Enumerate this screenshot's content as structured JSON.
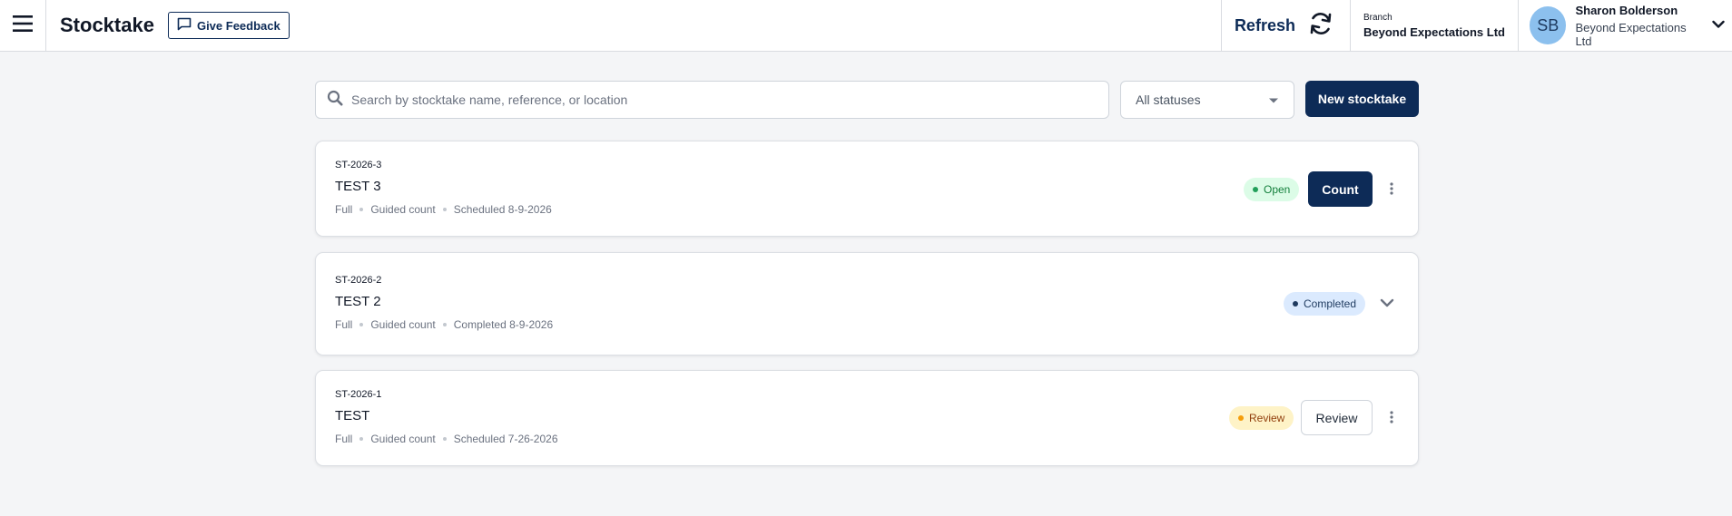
{
  "header": {
    "title": "Stocktake",
    "feedback_label": "Give Feedback",
    "refresh_label": "Refresh",
    "branch_caption": "Branch",
    "branch_name": "Beyond Expectations Ltd",
    "user": {
      "initials": "SB",
      "name": "Sharon Bolderson",
      "company": "Beyond Expectations Ltd"
    }
  },
  "toolbar": {
    "search_placeholder": "Search by stocktake name, reference, or location",
    "status_filter": "All statuses",
    "new_button": "New stocktake"
  },
  "stocktakes": [
    {
      "reference": "ST-2026-3",
      "name": "TEST 3",
      "scope": "Full",
      "method": "Guided count",
      "date_text": "Scheduled 8-9-2026",
      "status": "Open",
      "action": "Count"
    },
    {
      "reference": "ST-2026-2",
      "name": "TEST 2",
      "scope": "Full",
      "method": "Guided count",
      "date_text": "Completed 8-9-2026",
      "status": "Completed"
    },
    {
      "reference": "ST-2026-1",
      "name": "TEST",
      "scope": "Full",
      "method": "Guided count",
      "date_text": "Scheduled 7-26-2026",
      "status": "Review",
      "action": "Review"
    }
  ],
  "icons": {
    "menu": "hamburger-icon",
    "feedback": "chat-bubble-icon",
    "refresh": "refresh-icon",
    "search": "search-icon",
    "dropdown": "caret-down-icon",
    "more": "more-vertical-icon",
    "expand": "chevron-down-icon"
  },
  "colors": {
    "brand": "#0d2b57",
    "open": "#22a05a",
    "completed": "#1e3a5f",
    "review": "#f59e0b"
  }
}
